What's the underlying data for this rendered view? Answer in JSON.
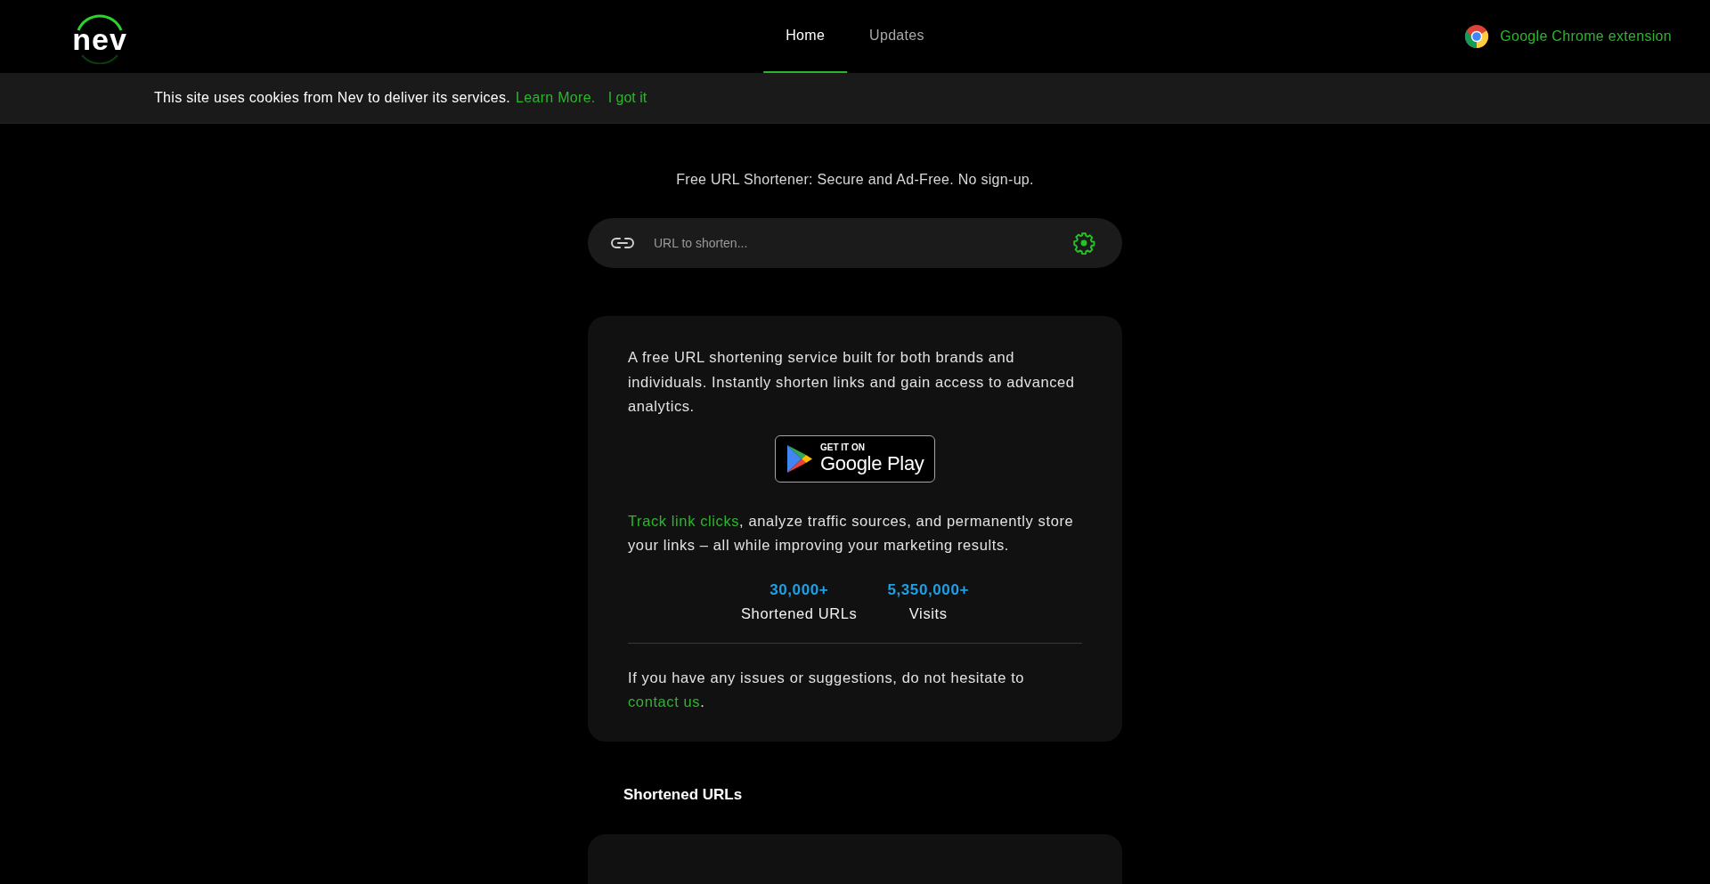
{
  "header": {
    "logo": "nev",
    "nav": [
      {
        "label": "Home",
        "selected": true
      },
      {
        "label": "Updates",
        "selected": false
      }
    ],
    "extension_link": "Google Chrome extension"
  },
  "cookie_bar": {
    "text": "This site uses cookies from Nev to deliver its services.",
    "learn_more": "Learn More.",
    "accept": "I got it"
  },
  "tagline": "Free URL Shortener: Secure and Ad-Free. No sign-up.",
  "url_input": {
    "placeholder": "URL to shorten..."
  },
  "info_card": {
    "intro": "A free URL shortening service built for both brands and individuals. Instantly shorten links and gain access to advanced analytics.",
    "store_badge": {
      "small": "GET IT ON",
      "large": "Google Play"
    },
    "feature": {
      "link": "Track link clicks",
      "text": ", analyze traffic sources, and permanently store your links – all while improving your marketing results."
    },
    "stats": [
      {
        "value": "30,000+",
        "label": "Shortened URLs"
      },
      {
        "value": "5,350,000+",
        "label": "Visits"
      }
    ],
    "contact": {
      "text": "If you have any issues or suggestions, do not hesitate to ",
      "link": "contact us",
      "after": "."
    }
  },
  "shortened_urls": {
    "heading": "Shortened URLs"
  }
}
